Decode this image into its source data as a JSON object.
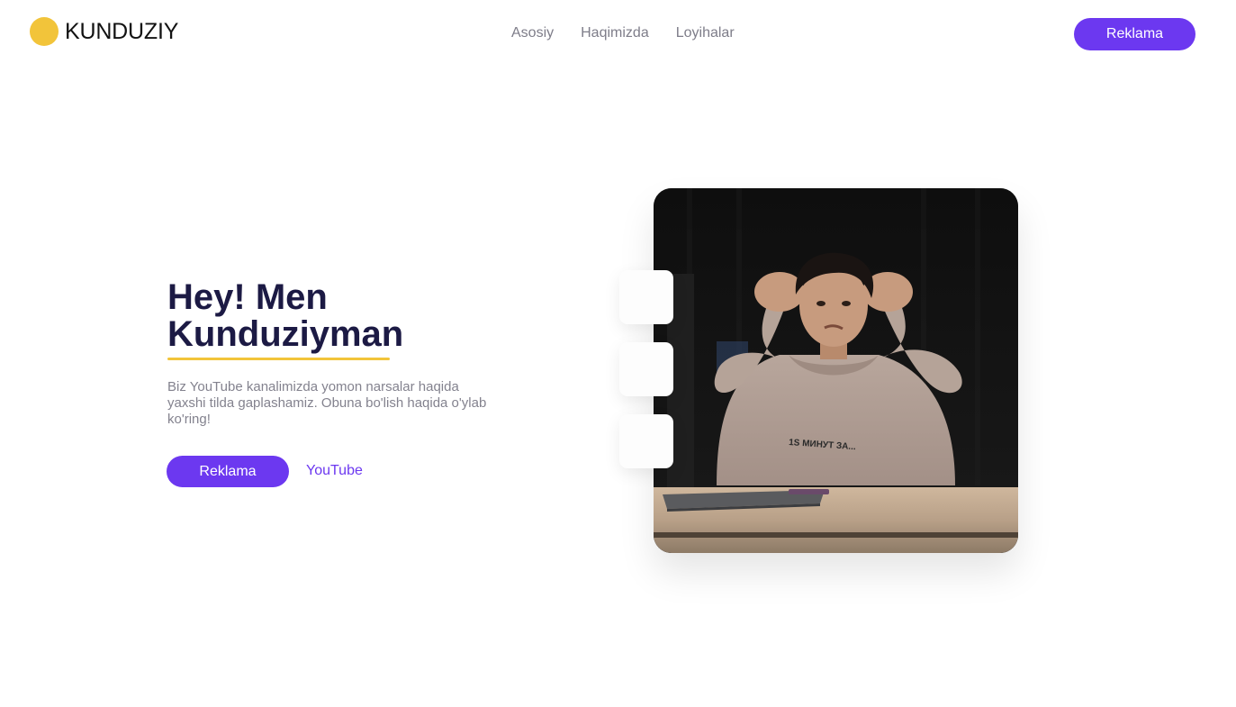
{
  "header": {
    "logo_text": "KUNDUZIY",
    "nav": [
      "Asosiy",
      "Haqimizda",
      "Loyihalar"
    ],
    "cta_label": "Reklama"
  },
  "hero": {
    "title_line1": "Hey! Men",
    "title_line2": "Kunduziyman",
    "description": "Biz YouTube kanalimizda yomon narsalar haqida yaxshi tilda gaplashamiz. Obuna bo'lish haqida o'ylab ko'ring!",
    "cta_label": "Reklama",
    "link_label": "YouTube"
  },
  "photo": {
    "sweater_text": "1S МИНУТ ЗА..."
  },
  "colors": {
    "accent": "#6c38f0",
    "logo_dot": "#f2c43a",
    "title": "#1c1a44",
    "muted_text": "#83828e"
  }
}
